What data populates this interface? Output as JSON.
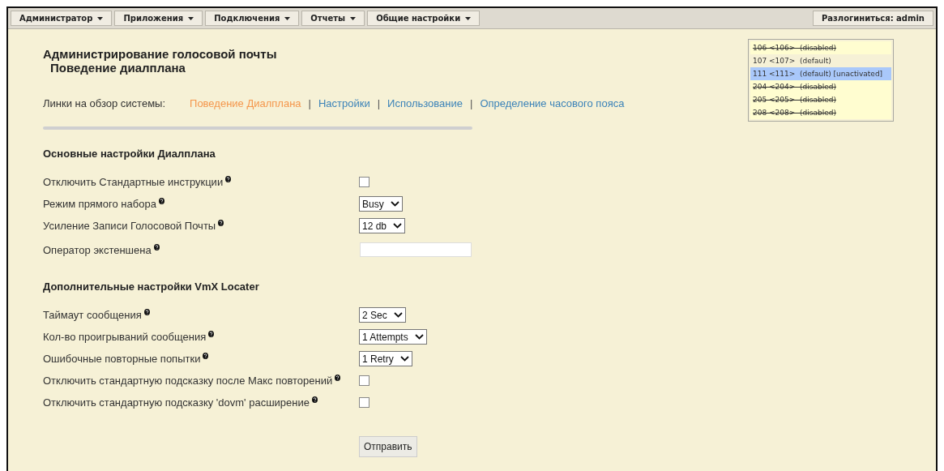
{
  "menu": [
    {
      "label": "Администратор"
    },
    {
      "label": "Приложения"
    },
    {
      "label": "Подключения"
    },
    {
      "label": "Отчеты"
    },
    {
      "label": "Общие настройки"
    }
  ],
  "logout": "Разлогиниться: admin",
  "title": "Администрирование голосовой почты",
  "subtitle": "Поведение диалплана",
  "links": {
    "label": "Линки на обзор системы:",
    "separator": "|",
    "items": [
      {
        "label": "Поведение Диалплана",
        "selected": true
      },
      {
        "label": "Настройки",
        "selected": false
      },
      {
        "label": "Использование",
        "selected": false
      },
      {
        "label": "Определение часового пояса",
        "selected": false
      }
    ]
  },
  "extensions": [
    {
      "label": "106 <106>  (disabled)",
      "disabled": true,
      "selected": false
    },
    {
      "label": "107 <107>  (default)",
      "disabled": false,
      "selected": false
    },
    {
      "label": "111 <111>  (default) [unactivated]",
      "disabled": false,
      "selected": true
    },
    {
      "label": "204 <204>  (disabled)",
      "disabled": true,
      "selected": false
    },
    {
      "label": "205 <205>  (disabled)",
      "disabled": true,
      "selected": false
    },
    {
      "label": "208 <208>  (disabled)",
      "disabled": true,
      "selected": false
    }
  ],
  "sections": [
    {
      "heading": "Основные настройки Диалплана",
      "fields": [
        {
          "kind": "checkbox",
          "label": "Отключить Стандартные инструкции",
          "checked": false
        },
        {
          "kind": "select",
          "label": "Режим прямого набора",
          "value": "Busy"
        },
        {
          "kind": "select",
          "label": "Усиление Записи Голосовой Почты",
          "value": "12 db"
        },
        {
          "kind": "text",
          "label": "Оператор экстеншена"
        }
      ]
    },
    {
      "heading": "Дополнительные настройки VmX Locater",
      "fields": [
        {
          "kind": "select",
          "label": "Таймаут сообщения",
          "value": "2 Sec"
        },
        {
          "kind": "select",
          "label": "Кол-во проигрываний сообщения",
          "value": "1 Attempts"
        },
        {
          "kind": "select",
          "label": "Ошибочные повторные попытки",
          "value": "1 Retry"
        },
        {
          "kind": "checkbox",
          "label": "Отключить стандартную подсказку после Макс повторений",
          "checked": false
        },
        {
          "kind": "checkbox",
          "label": "Отключить стандартную подсказку 'dovm' расширение",
          "checked": false
        }
      ]
    }
  ],
  "submit": "Отправить"
}
